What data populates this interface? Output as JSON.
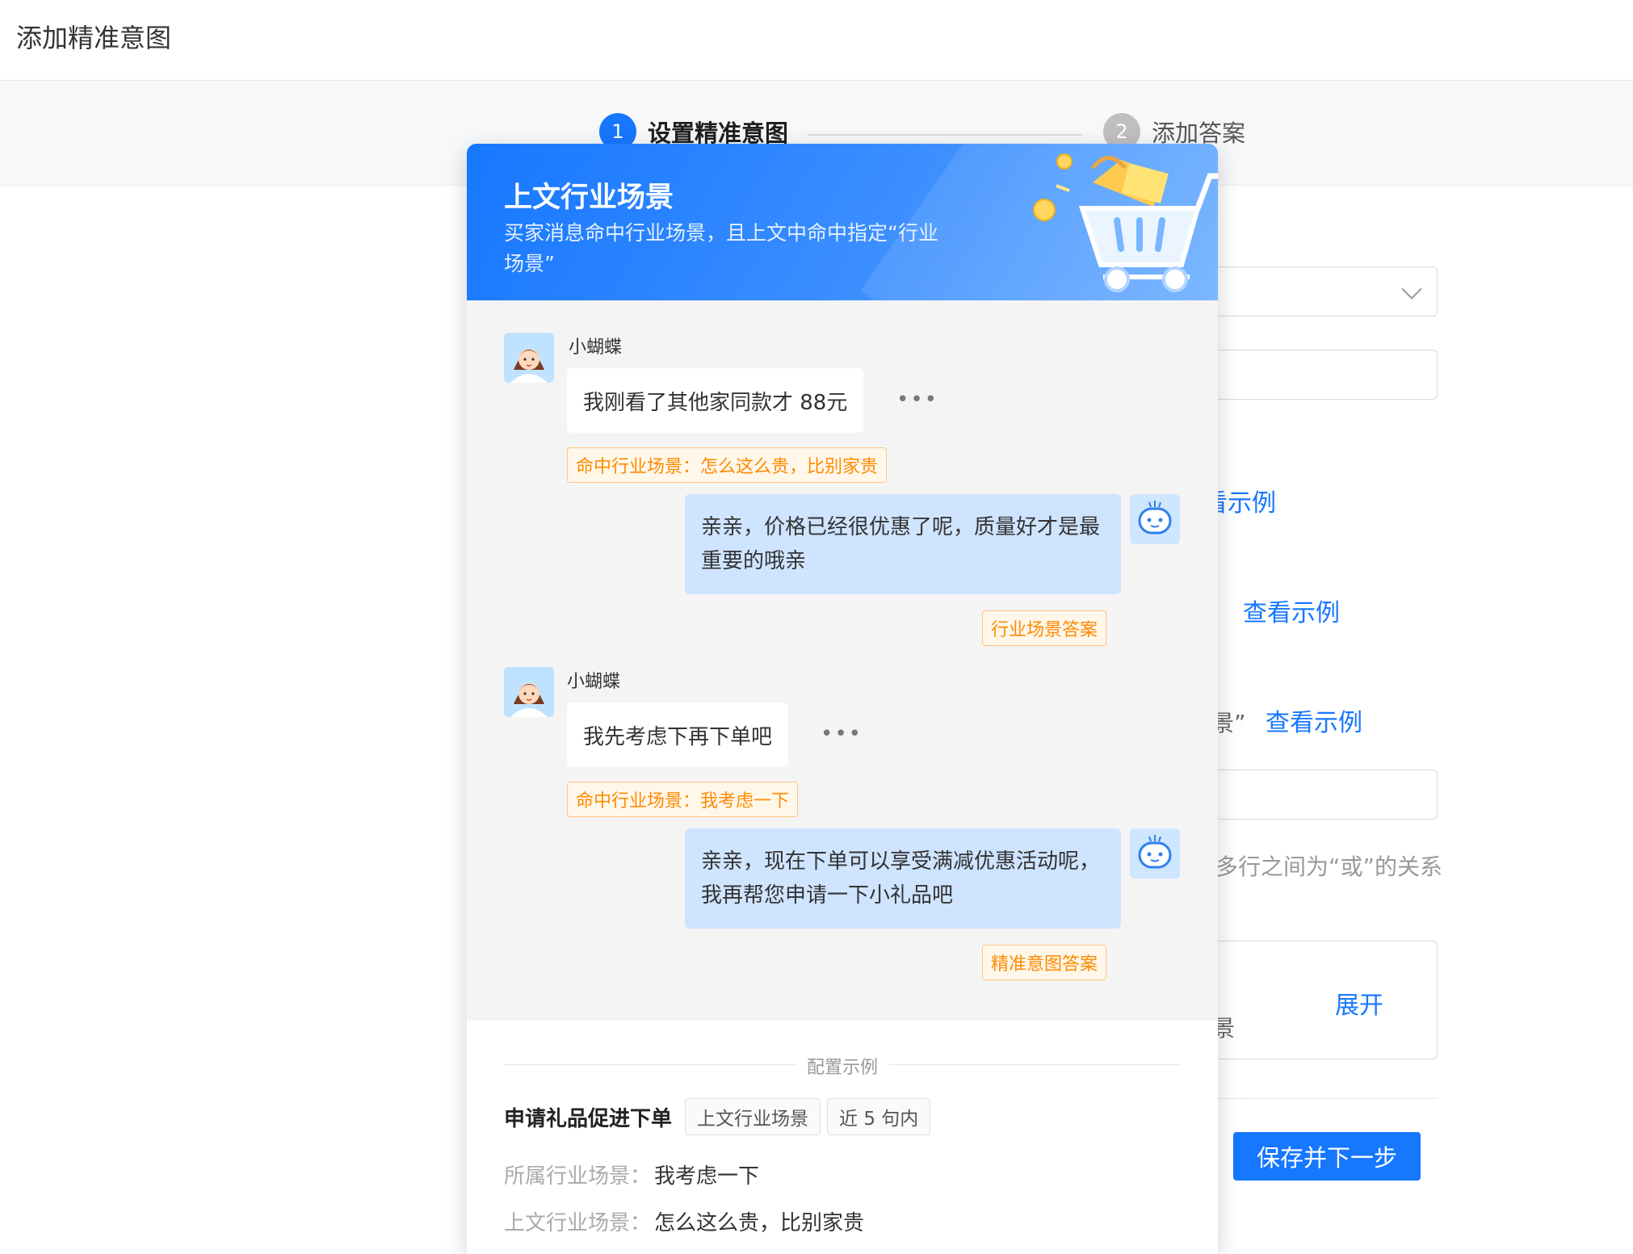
{
  "page": {
    "title": "添加精准意图"
  },
  "steps": [
    {
      "num": "1",
      "label": "设置精准意图"
    },
    {
      "num": "2",
      "label": "添加答案"
    }
  ],
  "background": {
    "link1": "看示例",
    "link2": "查看示例",
    "quote_frag": "景”",
    "link3": "查看示例",
    "hint": "多行之间为“或”的关系",
    "box_frag": "景",
    "expand": "展开",
    "save_button": "保存并下一步"
  },
  "popup": {
    "title": "上文行业场景",
    "desc": "买家消息命中行业场景，且上文中命中指定“行业场景”",
    "messages": [
      {
        "user": "小蝴蝶",
        "text": "我刚看了其他家同款才 88元",
        "more": "•••",
        "tag": "命中行业场景：怎么这么贵，比别家贵"
      },
      {
        "reply": "亲亲，价格已经很优惠了呢，质量好才是最重要的哦亲",
        "tag": "行业场景答案"
      },
      {
        "user": "小蝴蝶",
        "text": "我先考虑下再下单吧",
        "more": "•••",
        "tag": "命中行业场景：我考虑一下"
      },
      {
        "reply": "亲亲，现在下单可以享受满减优惠活动呢，我再帮您申请一下小礼品吧",
        "tag": "精准意图答案"
      }
    ],
    "example": {
      "section_label": "配置示例",
      "name": "申请礼品促进下单",
      "chips": [
        "上文行业场景",
        "近 5 句内"
      ],
      "rows": [
        {
          "k": "所属行业场景：",
          "v": "我考虑一下"
        },
        {
          "k": "上文行业场景：",
          "v": "怎么这么贵，比别家贵"
        }
      ]
    }
  },
  "colors": {
    "primary": "#1677ff",
    "tag_orange": "#ff8a00",
    "bot_bubble": "#cfe4ff"
  }
}
